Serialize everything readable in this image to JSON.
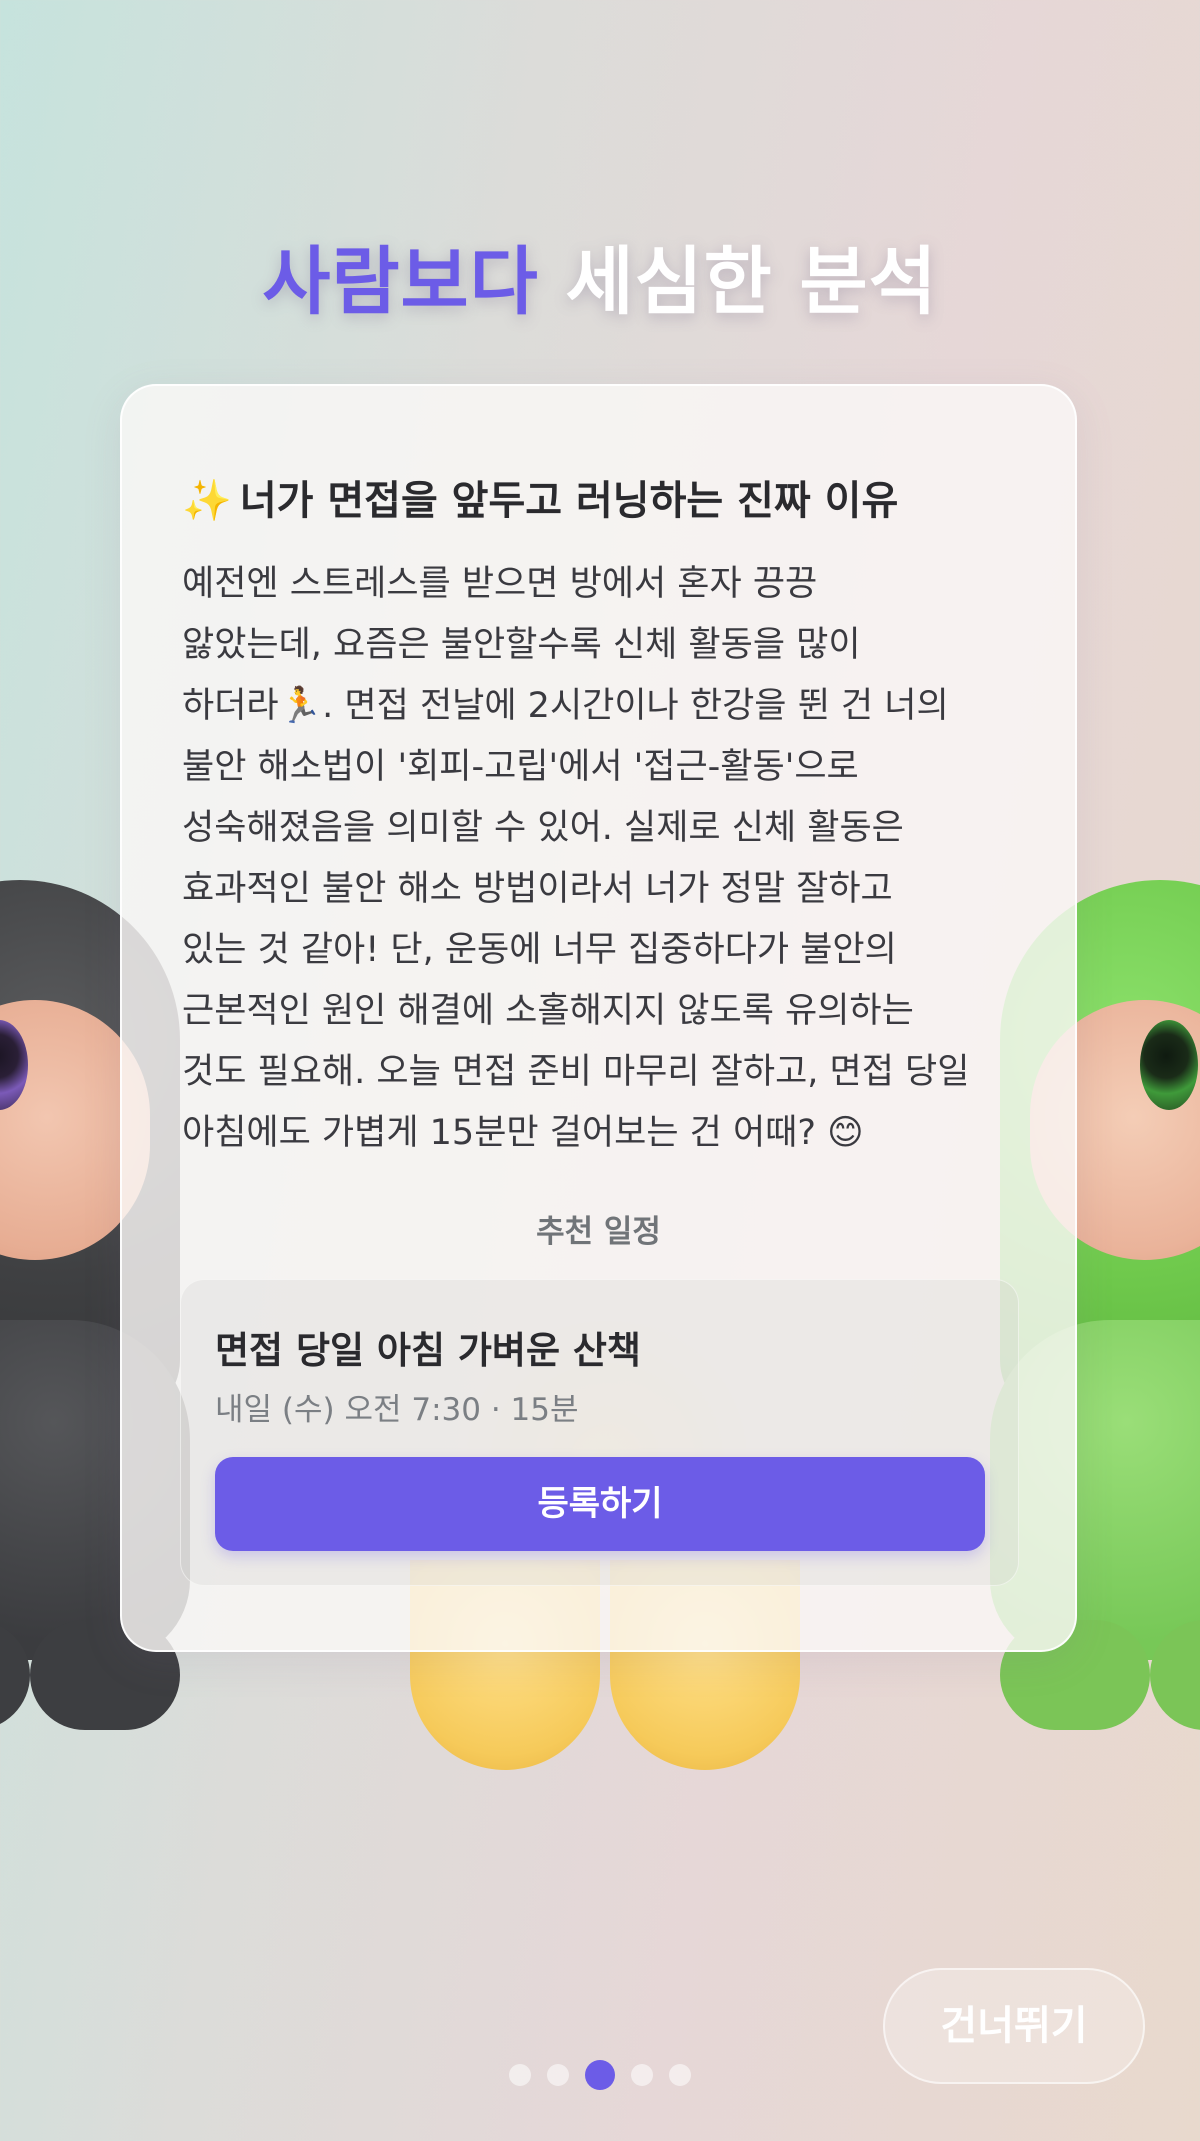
{
  "headline": {
    "accent": "사람보다",
    "rest": " 세심한 분석",
    "accent_color": "#6c5ce7"
  },
  "card": {
    "title_icon": "sparkles-icon",
    "title_emoji": "✨",
    "title": "너가 면접을 앞두고 러닝하는 진짜 이유",
    "body_lines": [
      "예전엔 스트레스를 받으면 방에서 혼자 끙끙",
      "앓았는데, 요즘은 불안할수록 신체 활동을 많이",
      "하더라🏃. 면접 전날에 2시간이나 한강을 뛴 건 너의",
      "불안 해소법이 '회피-고립'에서 '접근-활동'으로",
      "성숙해졌음을 의미할 수 있어. 실제로 신체 활동은",
      "효과적인 불안 해소 방법이라서 너가 정말 잘하고",
      "있는 것 같아! 단, 운동에 너무 집중하다가 불안의",
      "근본적인 원인 해결에 소홀해지지 않도록 유의하는",
      "것도 필요해. 오늘 면접 준비 마무리 잘하고, 면접 당일",
      "아침에도 가볍게 15분만 걸어보는 건 어때? 😊"
    ],
    "schedule_caption": "추천 일정",
    "schedule": {
      "title": "면접 당일 아침 가벼운 산책",
      "meta": "내일 (수) 오전 7:30 · 15분",
      "register_label": "등록하기"
    }
  },
  "pager": {
    "total": 5,
    "active_index": 2
  },
  "skip_label": "건너뛰기"
}
